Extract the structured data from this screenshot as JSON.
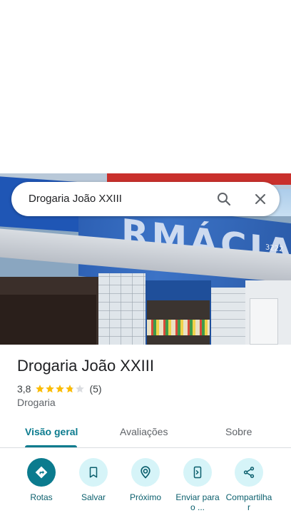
{
  "search": {
    "query": "Drogaria João XXIII"
  },
  "photo": {
    "banner_text": "RMÁCIA",
    "banner_phone": "3222\n3535"
  },
  "place": {
    "name": "Drogaria João XXIII",
    "rating": "3,8",
    "rating_stars": 3.8,
    "review_count": "(5)",
    "category": "Drogaria"
  },
  "tabs": [
    {
      "label": "Visão geral",
      "active": true
    },
    {
      "label": "Avaliações",
      "active": false
    },
    {
      "label": "Sobre",
      "active": false
    }
  ],
  "actions": [
    {
      "label": "Rotas",
      "icon": "directions-icon"
    },
    {
      "label": "Salvar",
      "icon": "bookmark-icon"
    },
    {
      "label": "Próximo",
      "icon": "nearby-icon"
    },
    {
      "label": "Enviar para o ...",
      "icon": "send-to-phone-icon"
    },
    {
      "label": "Compartilha r",
      "icon": "share-icon"
    }
  ],
  "colors": {
    "accent": "#0b7b8e",
    "action_bg": "#d6f4f8",
    "star": "#fbbc04",
    "star_empty": "#dadce0"
  }
}
